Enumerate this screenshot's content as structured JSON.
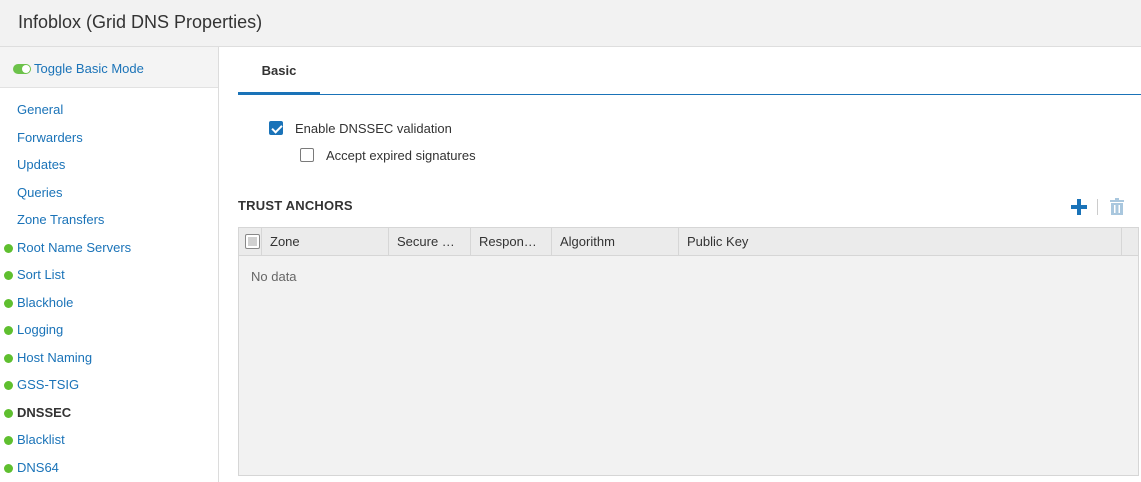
{
  "window": {
    "title": "Infoblox (Grid DNS Properties)"
  },
  "sidebar": {
    "toggle_label": "Toggle Basic Mode",
    "items": [
      {
        "label": "General",
        "dot": false,
        "active": false
      },
      {
        "label": "Forwarders",
        "dot": false,
        "active": false
      },
      {
        "label": "Updates",
        "dot": false,
        "active": false
      },
      {
        "label": "Queries",
        "dot": false,
        "active": false
      },
      {
        "label": "Zone Transfers",
        "dot": false,
        "active": false
      },
      {
        "label": "Root Name Servers",
        "dot": true,
        "active": false
      },
      {
        "label": "Sort List",
        "dot": true,
        "active": false
      },
      {
        "label": "Blackhole",
        "dot": true,
        "active": false
      },
      {
        "label": "Logging",
        "dot": true,
        "active": false
      },
      {
        "label": "Host Naming",
        "dot": true,
        "active": false
      },
      {
        "label": "GSS-TSIG",
        "dot": true,
        "active": false
      },
      {
        "label": "DNSSEC",
        "dot": true,
        "active": true
      },
      {
        "label": "Blacklist",
        "dot": true,
        "active": false
      },
      {
        "label": "DNS64",
        "dot": true,
        "active": false
      }
    ]
  },
  "tabs": [
    {
      "label": "Basic",
      "active": true
    }
  ],
  "options": {
    "enable_dnssec": {
      "label": "Enable DNSSEC validation",
      "checked": true
    },
    "accept_expired": {
      "label": "Accept expired signatures",
      "checked": false
    }
  },
  "trust_anchors": {
    "title": "TRUST ANCHORS",
    "add_icon": "plus-icon",
    "delete_icon": "trash-icon",
    "columns": [
      "Zone",
      "Secure …",
      "Respon…",
      "Algorithm",
      "Public Key"
    ],
    "empty_text": "No data"
  },
  "colors": {
    "accent": "#1a73b8",
    "status_dot": "#5fbf2f",
    "toggle_on": "#6cc24a"
  }
}
